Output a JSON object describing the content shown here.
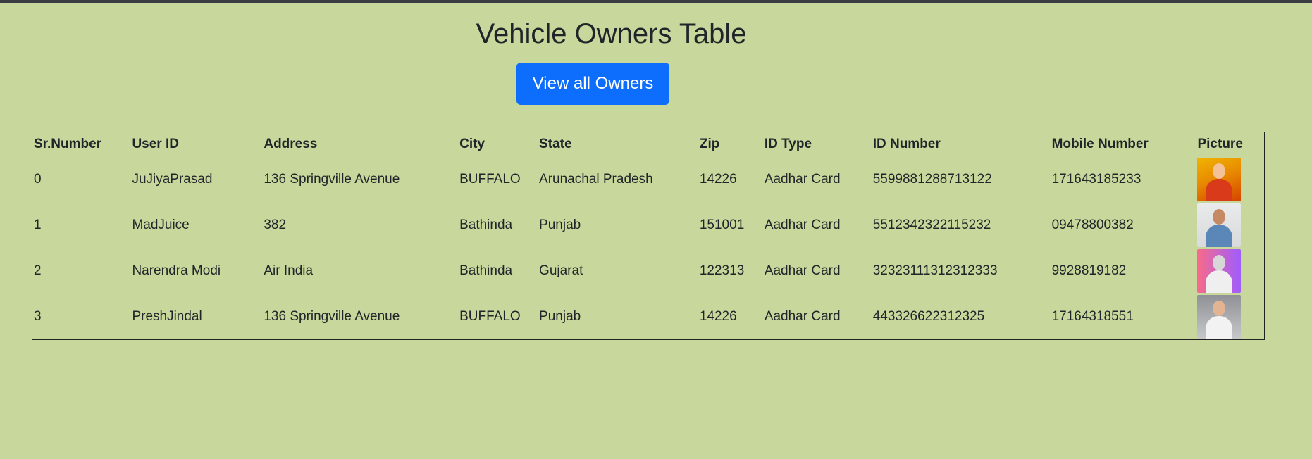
{
  "page": {
    "title": "Vehicle Owners Table",
    "view_button_label": "View all Owners"
  },
  "table": {
    "columns": [
      "Sr.Number",
      "User ID",
      "Address",
      "City",
      "State",
      "Zip",
      "ID Type",
      "ID Number",
      "Mobile Number",
      "Picture"
    ],
    "rows": [
      {
        "sr": "0",
        "user_id": "JuJiyaPrasad",
        "address": "136 Springville Avenue",
        "city": "BUFFALO",
        "state": "Arunachal Pradesh",
        "zip": "14226",
        "id_type": "Aadhar Card",
        "id_number": "5599881288713122",
        "mobile": "171643185233",
        "picture": "owner-photo-red-hoodie"
      },
      {
        "sr": "1",
        "user_id": "MadJuice",
        "address": "382",
        "city": "Bathinda",
        "state": "Punjab",
        "zip": "151001",
        "id_type": "Aadhar Card",
        "id_number": "5512342322115232",
        "mobile": "09478800382",
        "picture": "owner-photo-blue-shirt"
      },
      {
        "sr": "2",
        "user_id": "Narendra Modi",
        "address": "Air India",
        "city": "Bathinda",
        "state": "Gujarat",
        "zip": "122313",
        "id_type": "Aadhar Card",
        "id_number": "32323111312312333",
        "mobile": "9928819182",
        "picture": "owner-photo-statue"
      },
      {
        "sr": "3",
        "user_id": "PreshJindal",
        "address": "136 Springville Avenue",
        "city": "BUFFALO",
        "state": "Punjab",
        "zip": "14226",
        "id_type": "Aadhar Card",
        "id_number": "443326622312325",
        "mobile": "17164318551",
        "picture": "owner-photo-glasses"
      }
    ]
  },
  "colors": {
    "background": "#c8d79b",
    "button": "#0d6efd",
    "top_bar": "#3a3d41"
  }
}
